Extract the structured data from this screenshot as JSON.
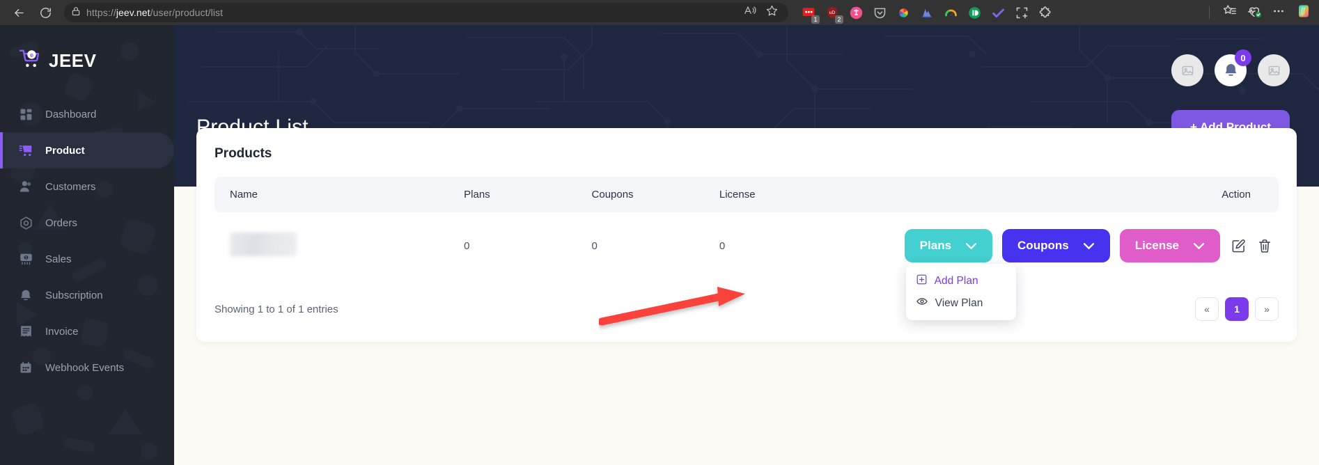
{
  "browser": {
    "back_icon": "back-arrow-icon",
    "reload_icon": "reload-icon",
    "lock_icon": "lock-icon",
    "url_prefix": "https://",
    "url_domain": "jeev.net",
    "url_path": "/user/product/list",
    "read_aloud_icon": "read-aloud-icon",
    "favorite_icon": "star-icon",
    "extensions": [
      {
        "name": "extension-red-dots",
        "badge": "1",
        "color": "#e02020"
      },
      {
        "name": "extension-ublock-shield",
        "badge": "2",
        "color": "#8f1f1f"
      },
      {
        "name": "extension-pink-circle",
        "badge": "",
        "color": "#f0508c"
      },
      {
        "name": "extension-pocket-shield",
        "badge": "",
        "color": "#b8bcc4"
      },
      {
        "name": "extension-color-wheel",
        "badge": "",
        "color": "#34c759"
      },
      {
        "name": "extension-blue-chart",
        "badge": "",
        "color": "#6f86d6"
      },
      {
        "name": "extension-gauge",
        "badge": "",
        "color": "#34c759"
      },
      {
        "name": "extension-green-circle",
        "badge": "",
        "color": "#0f9d58"
      },
      {
        "name": "extension-purple-check",
        "badge": "",
        "color": "#7b68ee"
      },
      {
        "name": "extension-crop-frame",
        "badge": "",
        "color": "#c9c9c9"
      },
      {
        "name": "extension-puzzle-outline",
        "badge": "",
        "color": "#c9c9c9"
      }
    ],
    "collections_icon": "collections-icon",
    "browser_essentials_icon": "browser-essentials-icon",
    "settings_icon": "more-options-icon",
    "copilot_icon": "copilot-icon"
  },
  "sidebar": {
    "brand": "JEEV",
    "brand_mark": "cart-e-logo",
    "items": [
      {
        "label": "Dashboard",
        "icon": "dashboard-grid-icon",
        "active": false
      },
      {
        "label": "Product",
        "icon": "cart-icon",
        "active": true
      },
      {
        "label": "Customers",
        "icon": "user-icon",
        "active": false
      },
      {
        "label": "Orders",
        "icon": "hexagon-orders-icon",
        "active": false
      },
      {
        "label": "Sales",
        "icon": "money-sales-icon",
        "active": false
      },
      {
        "label": "Subscription",
        "icon": "bell-icon",
        "active": false
      },
      {
        "label": "Invoice",
        "icon": "invoice-doc-icon",
        "active": false
      },
      {
        "label": "Webhook Events",
        "icon": "calendar-events-icon",
        "active": false
      }
    ]
  },
  "topbar": {
    "title": "Product List",
    "add_product_label": "+ Add Product",
    "left_icon": "image-placeholder-icon",
    "bell_icon": "bell-icon",
    "notification_count": "0",
    "right_icon": "image-placeholder-icon"
  },
  "card": {
    "title": "Products",
    "columns": [
      "Name",
      "Plans",
      "Coupons",
      "License",
      "Action"
    ],
    "rows": [
      {
        "name": "",
        "name_redacted": true,
        "plans": "0",
        "coupons": "0",
        "license": "0",
        "actions": [
          {
            "label": "Plans",
            "color": "#44cfd0",
            "icon": "chevron-down-icon"
          },
          {
            "label": "Coupons",
            "color": "#4733ef",
            "icon": "chevron-down-icon"
          },
          {
            "label": "License",
            "color": "#e05cc8",
            "icon": "chevron-down-icon"
          }
        ],
        "edit_icon": "edit-pencil-icon",
        "delete_icon": "trash-icon"
      }
    ],
    "dropdown": {
      "open": true,
      "items": [
        {
          "label": "Add Plan",
          "icon": "plus-square-icon",
          "highlighted": true
        },
        {
          "label": "View Plan",
          "icon": "eye-icon",
          "highlighted": false
        }
      ]
    },
    "entries_text": "Showing 1 to 1 of 1 entries",
    "pagination": {
      "prev_label": "«",
      "pages": [
        "1"
      ],
      "next_label": "»",
      "active_page": "1"
    }
  },
  "annotation": {
    "arrow_icon": "red-pointer-arrow",
    "arrow_color": "#f9423a"
  },
  "colors": {
    "accent_purple": "#7c3aed",
    "sidebar_bg": "#21262e",
    "topbar_bg": "#1f2740",
    "page_bg": "#fdfbf5"
  }
}
